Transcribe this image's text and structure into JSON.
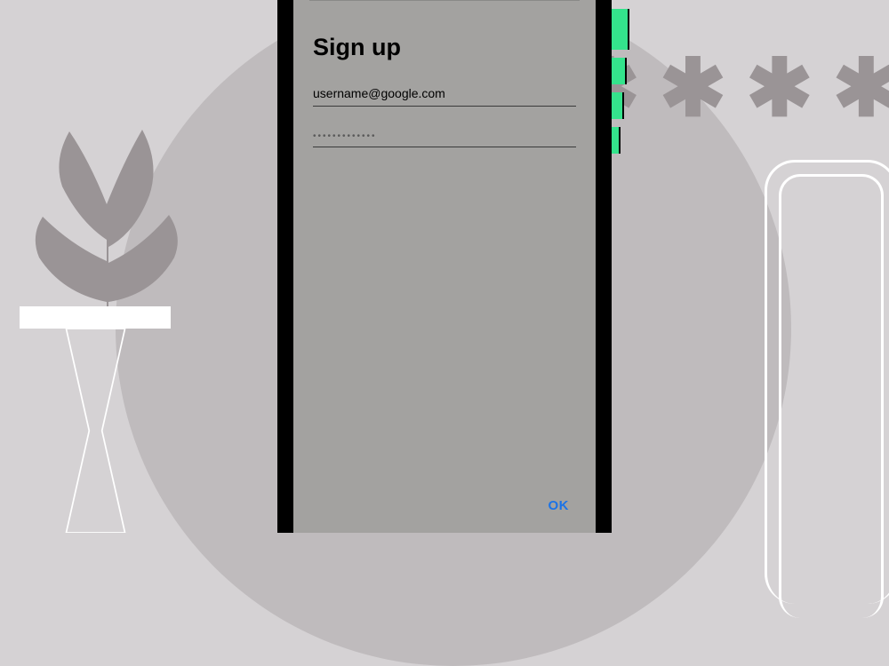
{
  "signup": {
    "title": "Sign up",
    "username_value": "username@google.com",
    "password_value": "•••••••••••••",
    "ok_label": "OK"
  },
  "decor": {
    "asterisks": [
      "✱",
      "✱",
      "✱",
      "✱"
    ]
  },
  "colors": {
    "accent_green": "#34e38c",
    "link_blue": "#1a73e8",
    "background": "#d5d2d4",
    "circle": "#bfbbbd",
    "screen": "#a3a2a0"
  }
}
